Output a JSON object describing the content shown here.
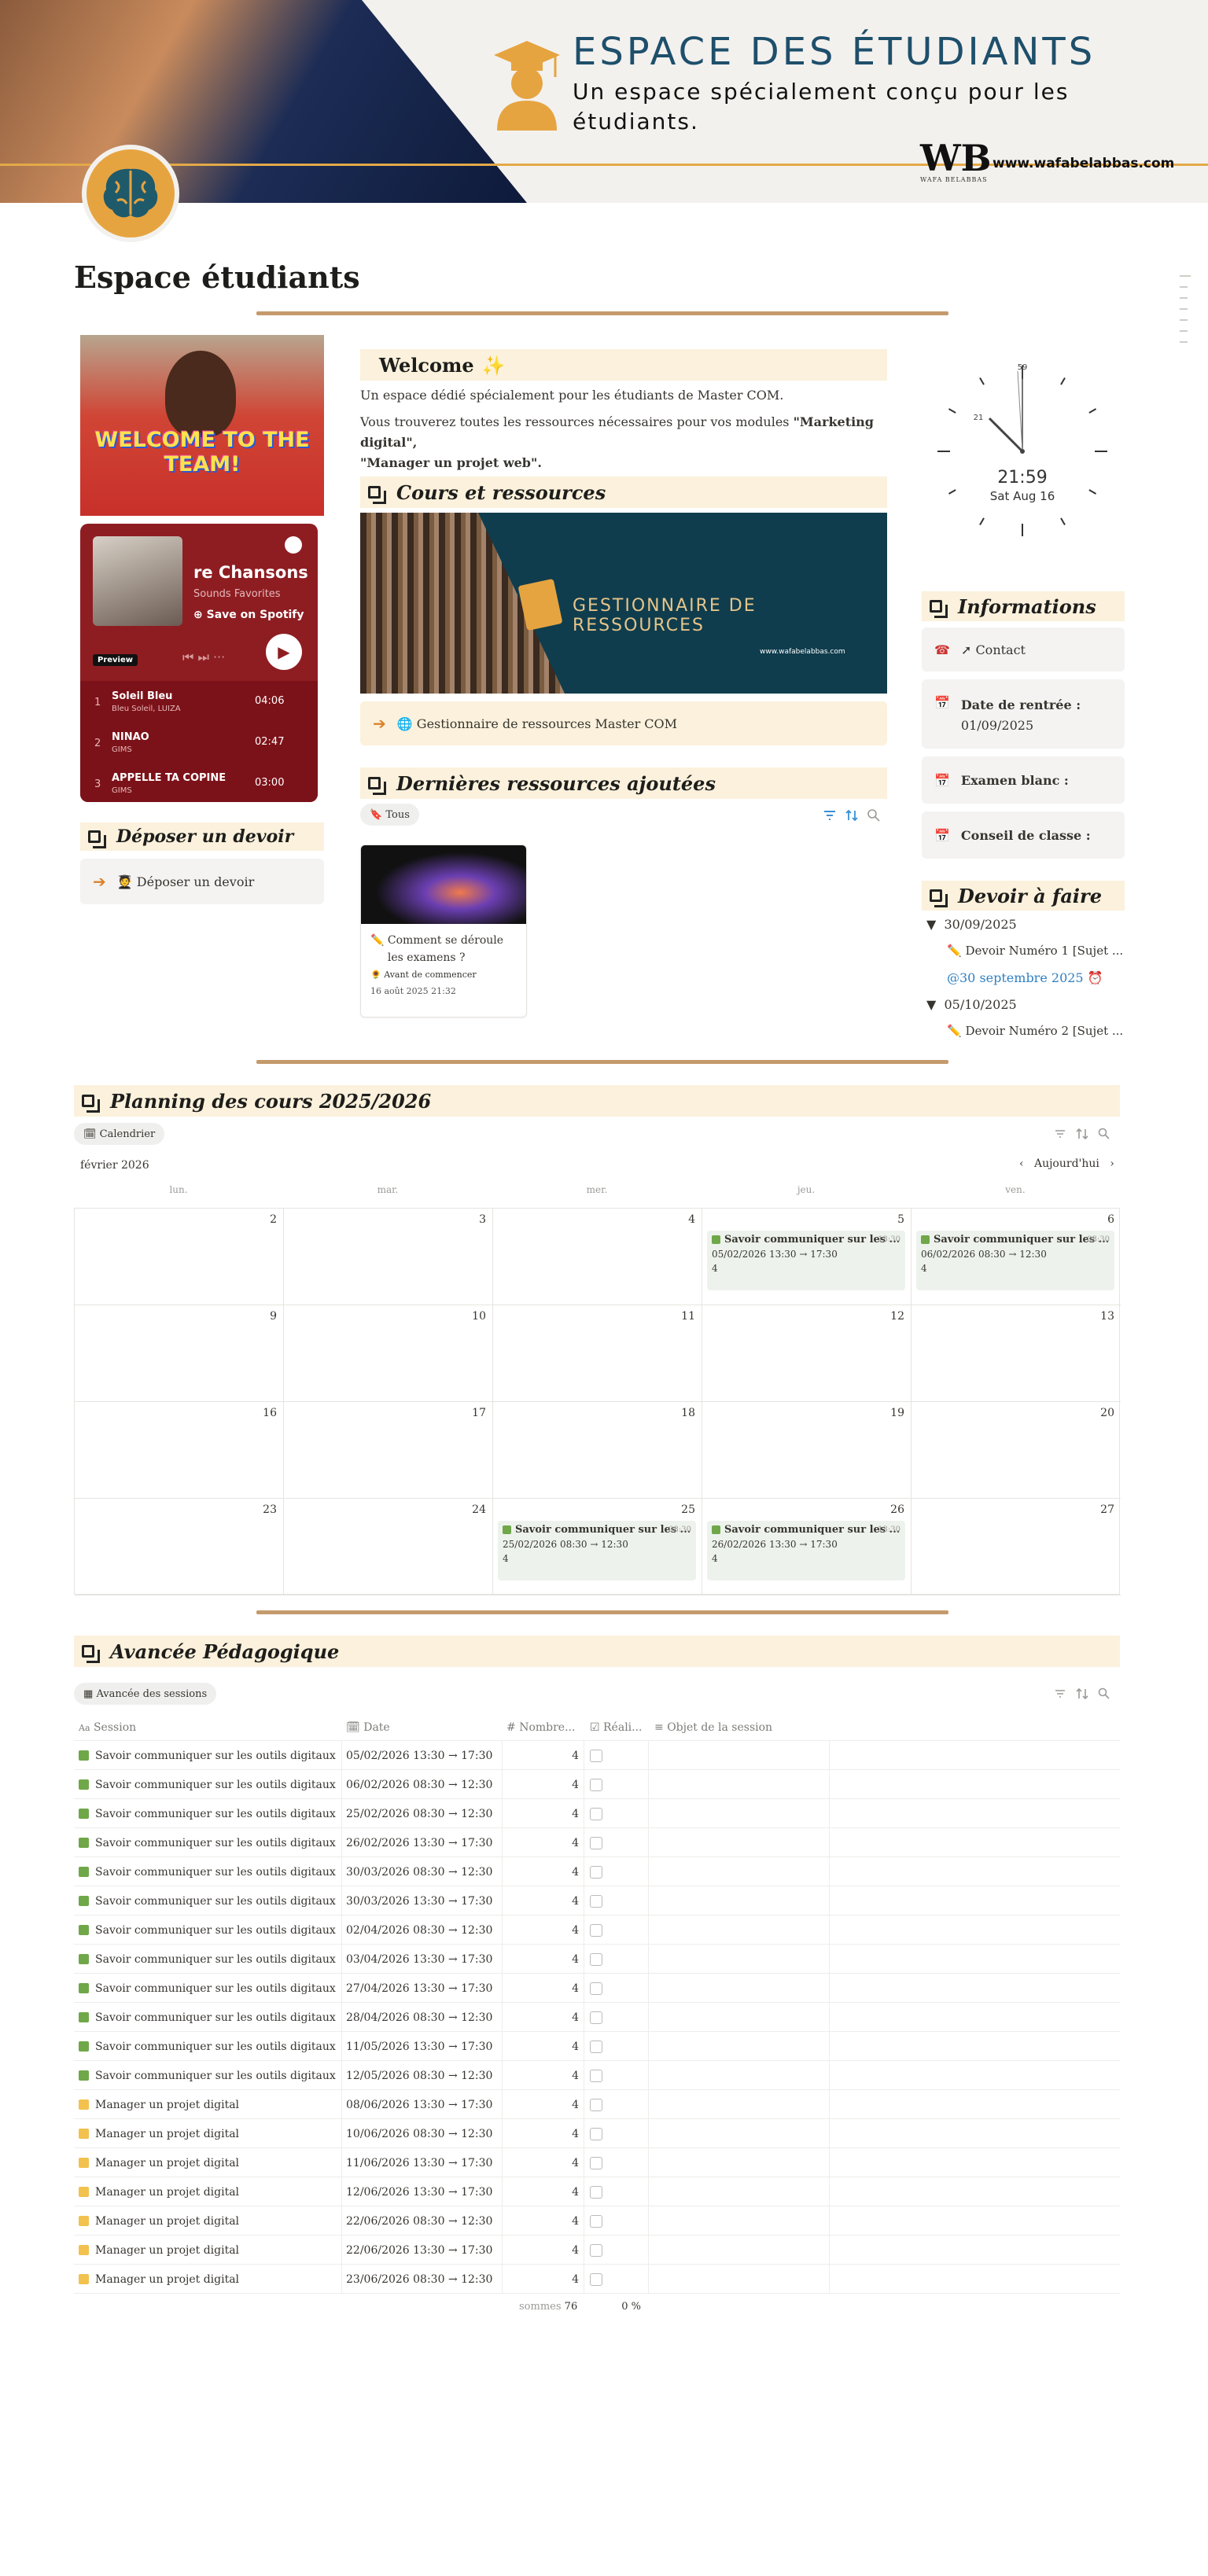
{
  "banner": {
    "title": "ESPACE DES ÉTUDIANTS",
    "subtitle": "Un espace spécialement conçu pour les étudiants.",
    "logo_text": "WB",
    "logo_sub": "WAFA BELABBAS",
    "url": "www.wafabelabbas.com"
  },
  "page_title": "Espace étudiants",
  "left": {
    "gif_text": "WELCOME TO THE TEAM!",
    "spotify": {
      "title": "re Chansons",
      "subtitle": "Sounds Favorites",
      "save": "Save on Spotify",
      "preview": "Preview",
      "tracks": [
        {
          "n": "1",
          "name": "Soleil Bleu",
          "artist": "Bleu Soleil, LUIZA",
          "dur": "04:06"
        },
        {
          "n": "2",
          "name": "NINAO",
          "artist": "GIMS",
          "dur": "02:47"
        },
        {
          "n": "3",
          "name": "APPELLE TA COPINE",
          "artist": "GIMS",
          "dur": "03:00"
        }
      ]
    },
    "deposer_header": "Déposer un devoir",
    "deposer_link": "Déposer un devoir"
  },
  "middle": {
    "welcome_header": "Welcome",
    "intro1": "Un espace dédié spécialement pour les étudiants de Master COM.",
    "intro2_a": "Vous trouverez toutes les ressources nécessaires pour vos modules ",
    "intro2_b": "\"Marketing digital\",",
    "intro2_c": "\"Manager un projet web\".",
    "cours_header": "Cours et ressources",
    "banner2_text": "GESTIONNAIRE DE RESSOURCES",
    "banner2_url": "www.wafabelabbas.com",
    "gestionnaire_link": "Gestionnaire de ressources Master COM",
    "dernieres_header": "Dernières ressources ajoutées",
    "view_tous": "Tous",
    "card": {
      "title": "Comment se déroule les examens ?",
      "tag": "Avant de commencer",
      "date": "16 août 2025 21:32"
    }
  },
  "right": {
    "clock_time": "21:59",
    "clock_date": "Sat Aug 16",
    "info_header": "Informations",
    "contact": "Contact",
    "rentree_label": "Date de rentrée :",
    "rentree_value": "01/09/2025",
    "examen_label": "Examen blanc :",
    "conseil_label": "Conseil de classe :",
    "devoir_header": "Devoir à faire",
    "devoirs": [
      {
        "date": "30/09/2025",
        "item": "Devoir Numéro 1 [Sujet ...",
        "mention": "@30 septembre 2025"
      },
      {
        "date": "05/10/2025",
        "item": "Devoir Numéro 2 [Sujet ..."
      }
    ]
  },
  "planning": {
    "header": "Planning des cours 2025/2026",
    "view": "Calendrier",
    "month": "février 2026",
    "today": "Aujourd'hui",
    "weekdays": [
      "lun.",
      "mar.",
      "mer.",
      "jeu.",
      "ven."
    ],
    "weeks": [
      [
        "2",
        "3",
        "4",
        "5",
        "6"
      ],
      [
        "9",
        "10",
        "11",
        "12",
        "13"
      ],
      [
        "16",
        "17",
        "18",
        "19",
        "20"
      ],
      [
        "23",
        "24",
        "25",
        "26",
        "27"
      ]
    ],
    "events": [
      {
        "title": "Savoir communiquer sur les ...",
        "time": "13:30",
        "range": "05/02/2026 13:30 → 17:30",
        "count": "4"
      },
      {
        "title": "Savoir communiquer sur les ...",
        "time": "08:30",
        "range": "06/02/2026 08:30 → 12:30",
        "count": "4"
      },
      {
        "title": "Savoir communiquer sur les ...",
        "time": "08:30",
        "range": "25/02/2026 08:30 → 12:30",
        "count": "4"
      },
      {
        "title": "Savoir communiquer sur les ...",
        "time": "13:30",
        "range": "26/02/2026 13:30 → 17:30",
        "count": "4"
      }
    ]
  },
  "avancee": {
    "header": "Avancée Pédagogique",
    "view": "Avancée des sessions",
    "columns": [
      "Session",
      "Date",
      "Nombre...",
      "Réali...",
      "Objet de la session"
    ],
    "rows": [
      {
        "session": "Savoir communiquer sur les outils digitaux",
        "date": "05/02/2026 13:30 → 17:30",
        "n": "4",
        "color": "#6fa749"
      },
      {
        "session": "Savoir communiquer sur les outils digitaux",
        "date": "06/02/2026 08:30 → 12:30",
        "n": "4",
        "color": "#6fa749"
      },
      {
        "session": "Savoir communiquer sur les outils digitaux",
        "date": "25/02/2026 08:30 → 12:30",
        "n": "4",
        "color": "#6fa749"
      },
      {
        "session": "Savoir communiquer sur les outils digitaux",
        "date": "26/02/2026 13:30 → 17:30",
        "n": "4",
        "color": "#6fa749"
      },
      {
        "session": "Savoir communiquer sur les outils digitaux",
        "date": "30/03/2026 08:30 → 12:30",
        "n": "4",
        "color": "#6fa749"
      },
      {
        "session": "Savoir communiquer sur les outils digitaux",
        "date": "30/03/2026 13:30 → 17:30",
        "n": "4",
        "color": "#6fa749"
      },
      {
        "session": "Savoir communiquer sur les outils digitaux",
        "date": "02/04/2026 08:30 → 12:30",
        "n": "4",
        "color": "#6fa749"
      },
      {
        "session": "Savoir communiquer sur les outils digitaux",
        "date": "03/04/2026 13:30 → 17:30",
        "n": "4",
        "color": "#6fa749"
      },
      {
        "session": "Savoir communiquer sur les outils digitaux",
        "date": "27/04/2026 13:30 → 17:30",
        "n": "4",
        "color": "#6fa749"
      },
      {
        "session": "Savoir communiquer sur les outils digitaux",
        "date": "28/04/2026 08:30 → 12:30",
        "n": "4",
        "color": "#6fa749"
      },
      {
        "session": "Savoir communiquer sur les outils digitaux",
        "date": "11/05/2026 13:30 → 17:30",
        "n": "4",
        "color": "#6fa749"
      },
      {
        "session": "Savoir communiquer sur les outils digitaux",
        "date": "12/05/2026 08:30 → 12:30",
        "n": "4",
        "color": "#6fa749"
      },
      {
        "session": "Manager un projet digital",
        "date": "08/06/2026 13:30 → 17:30",
        "n": "4",
        "color": "#f2c14e"
      },
      {
        "session": "Manager un projet digital",
        "date": "10/06/2026 08:30 → 12:30",
        "n": "4",
        "color": "#f2c14e"
      },
      {
        "session": "Manager un projet digital",
        "date": "11/06/2026 13:30 → 17:30",
        "n": "4",
        "color": "#f2c14e"
      },
      {
        "session": "Manager un projet digital",
        "date": "12/06/2026 13:30 → 17:30",
        "n": "4",
        "color": "#f2c14e"
      },
      {
        "session": "Manager un projet digital",
        "date": "22/06/2026 08:30 → 12:30",
        "n": "4",
        "color": "#f2c14e"
      },
      {
        "session": "Manager un projet digital",
        "date": "22/06/2026 13:30 → 17:30",
        "n": "4",
        "color": "#f2c14e"
      },
      {
        "session": "Manager un projet digital",
        "date": "23/06/2026 08:30 → 12:30",
        "n": "4",
        "color": "#f2c14e"
      }
    ],
    "sum_label": "sommes",
    "sum_value": "76",
    "pct_value": "0 %"
  },
  "colors": {
    "accent_gold": "#e6a440",
    "header_bg": "#fbf1dc",
    "divider": "#c49a6c",
    "teal": "#1e4f6b"
  }
}
